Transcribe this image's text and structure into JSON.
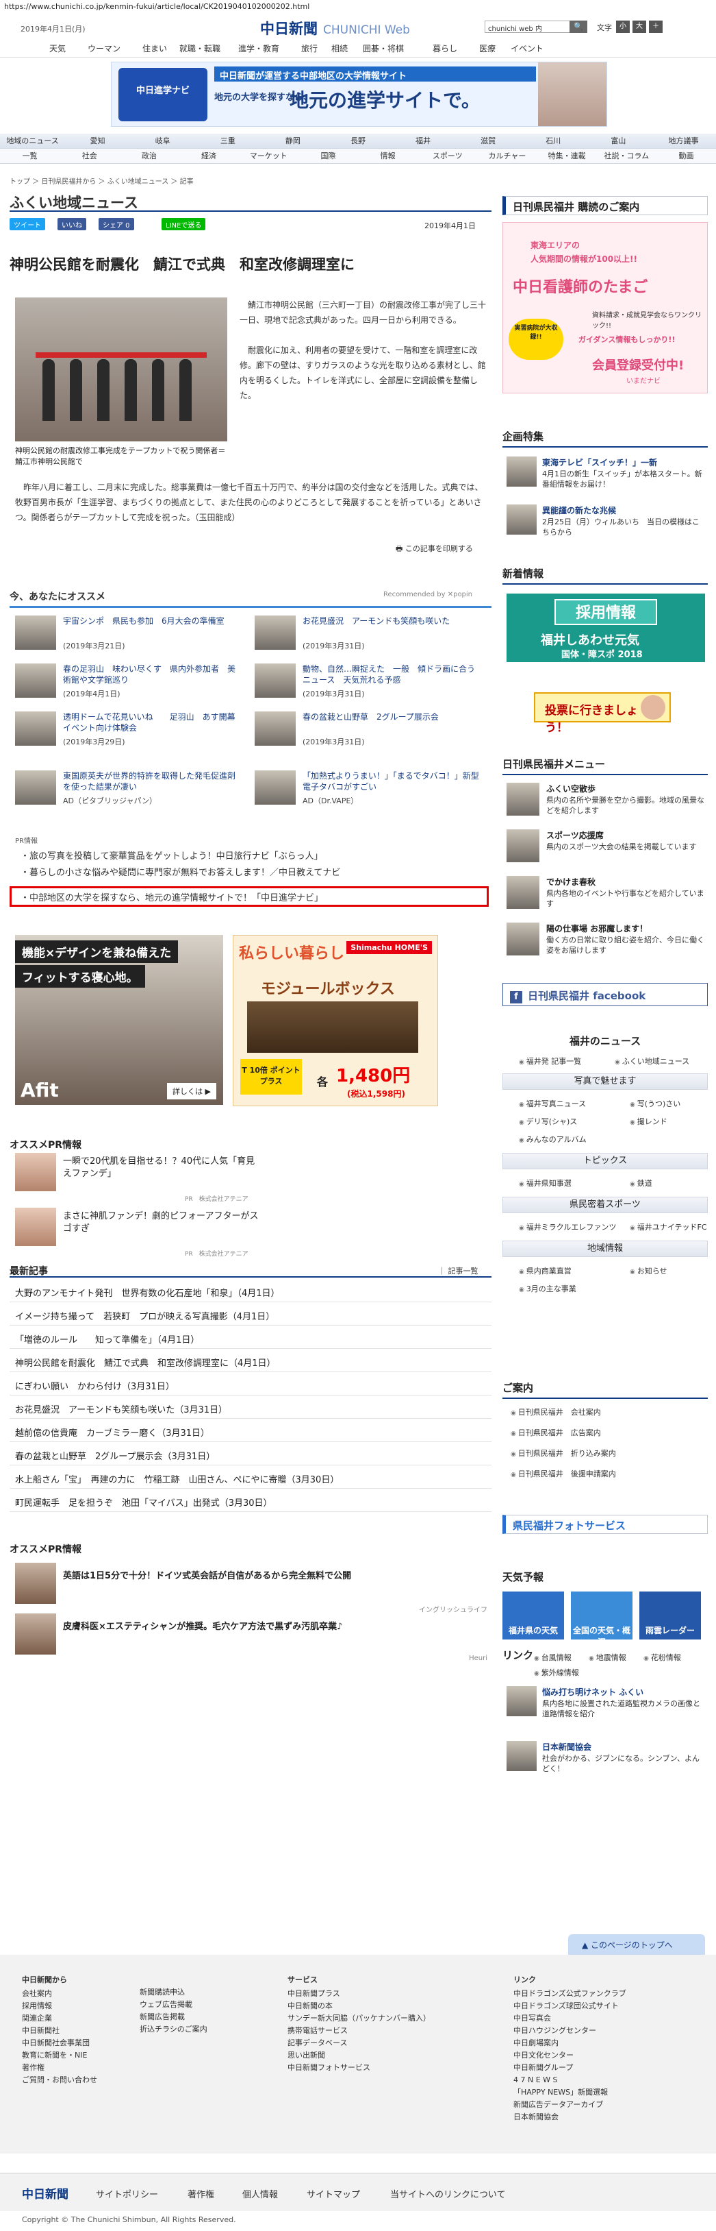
{
  "url": "https://www.chunichi.co.jp/kenmin-fukui/article/local/CK2019040102000202.html",
  "header": {
    "date": "2019年4月1日(月)",
    "logo": "中日新聞",
    "logo_sub": "CHUNICHI Web",
    "search_value": "chunichi web 内",
    "search_btn": "🔍",
    "font_label": "文字",
    "font_small": "小",
    "font_large": "大",
    "font_plus": "＋"
  },
  "topnav": [
    "天気",
    "ウーマン",
    "住まい",
    "就職・転職",
    "進学・教育",
    "旅行",
    "相続",
    "囲碁・将棋",
    "暮らし",
    "医療",
    "イベント"
  ],
  "banner": {
    "badge": "中日進学ナビ",
    "line1": "中日新聞が運営する中部地区の大学情報サイト",
    "line2": "地元の大学を探すなら、",
    "line3": "地元の進学サイトで。"
  },
  "secnav_row1": [
    "地域のニュース",
    "愛知",
    "岐阜",
    "三重",
    "静岡",
    "長野",
    "福井",
    "滋賀",
    "石川",
    "富山",
    "地方議事"
  ],
  "secnav_row2": [
    "一覧",
    "社会",
    "政治",
    "経済",
    "マーケット",
    "国際",
    "情報",
    "スポーツ",
    "カルチャー",
    "特集・連載",
    "社説・コラム",
    "動画"
  ],
  "crumb": "トップ ＞ 日刊県民福井から ＞ ふくい地域ニュース ＞ 記事",
  "page_title": "ふくい地域ニュース",
  "share": {
    "tweet": "ツイート",
    "fb": "いいね",
    "share": "シェア 0",
    "line": "LINEで送る"
  },
  "article": {
    "date": "2019年4月1日",
    "headline": "神明公民館を耐震化　鯖江で式典　和室改修調理室に",
    "caption": "神明公民館の耐震改修工事完成をテープカットで祝う関係者＝鯖江市神明公民館で",
    "p1": "鯖江市神明公民館（三六町一丁目）の耐震改修工事が完了し三十一日、現地で記念式典があった。四月一日から利用できる。",
    "p2": "耐震化に加え、利用者の要望を受けて、一階和室を調理室に改修。廊下の壁は、すりガラスのような光を取り込める素材とし、館内を明るくした。トイレを洋式にし、全部屋に空調設備を整備した。",
    "p3": "昨年八月に着工し、二月末に完成した。総事業費は一億七千百五十万円で、約半分は国の交付金などを活用した。式典では、牧野百男市長が「生涯学習、まちづくりの拠点として、また住民の心のよりどころとして発展することを祈っている」とあいさつ。関係者らがテープカットして完成を祝った。（玉田能成）",
    "print": "この記事を印刷する"
  },
  "rec": {
    "title": "今、あなたにオススメ",
    "by": "Recommended by ✕popin",
    "items": [
      {
        "t": "宇宙シンポ　県民も参加　6月大会の準備室",
        "d": "(2019年3月21日)"
      },
      {
        "t": "お花見盛況　アーモンドも笑顔も咲いた",
        "d": "(2019年3月31日)"
      },
      {
        "t": "春の足羽山　味わい尽くす　県内外参加者　美術館や文学館巡り",
        "d": "(2019年4月1日)"
      },
      {
        "t": "動物、自然…瞬捉えた　一般　傾ドラ画に合う　ニュース　天気荒れる予感",
        "d": "(2019年3月31日)"
      },
      {
        "t": "透明ドームで花見いいね　　足羽山　あす開幕イベント向け体験会",
        "d": "(2019年3月29日)"
      },
      {
        "t": "春の盆栽と山野草　2グループ展示会",
        "d": "(2019年3月31日)"
      },
      {
        "t": "東国原英夫が世界的特許を取得した発毛促進剤を使った結果が凄い",
        "d": "AD（ピタブリッジャパン）"
      },
      {
        "t": "「加熱式よりうまい！」「まるでタバコ！」新型電子タバコがすごい",
        "d": "AD（Dr.VAPE）"
      }
    ]
  },
  "pr": {
    "label": "PR情報",
    "lines": [
      "旅の写真を投稿して豪華賞品をゲットしよう！中日旅行ナビ「ぶらっ人」",
      "暮らしの小さな悩みや疑問に専門家が無料でお答えします！／中日教えてナビ",
      "中部地区の大学を探すなら、地元の進学情報サイトで！「中日進学ナビ」"
    ]
  },
  "ad1": {
    "l1": "機能×デザインを兼ね備えた",
    "l2": "フィットする寝心地。",
    "brand": "Afit",
    "more": "詳しくは ▶"
  },
  "ad2": {
    "l1": "私らしい暮らし",
    "l2": "モジュールボックス",
    "logo": "Shimachu HOME'S",
    "price": "1,480円",
    "kaku": "各",
    "tax": "(税込1,598円)",
    "point": "T 10倍 ポイントプラス"
  },
  "ospr1": {
    "title": "オススメPR情報",
    "items": [
      {
        "t": "一瞬で20代肌を目指せる！？40代に人気「育見えファンデ」",
        "s": "PR　株式会社アテニア"
      },
      {
        "t": "まさに神肌ファンデ！劇的ピフォーアフターがスゴすぎ",
        "s": "PR　株式会社アテニア"
      }
    ]
  },
  "latest": {
    "title": "最新記事",
    "more": "記事一覧",
    "items": [
      "大野のアンモナイト発刊　世界有数の化石産地「和泉」（4月1日）",
      "イメージ持ち撮って　若狭町　プロが映える写真撮影（4月1日）",
      "「増徳のルール　　知って準備を」（4月1日）",
      "神明公民館を耐震化　鯖江で式典　和室改修調理室に（4月1日）",
      "にぎわい願い　かわら付け（3月31日）",
      "お花見盛況　アーモンドも笑顔も咲いた（3月31日）",
      "越前億の信貴庵　カーブミラー磨く（3月31日）",
      "春の盆栽と山野草　2グループ展示会（3月31日）",
      "水上船さん「宝」　再建の力に　竹稲工跡　山田さん、ぺにやに寄贈（3月30日）",
      "町民運転手　足を担うぞ　池田「マイバス」出発式（3月30日）"
    ]
  },
  "ospr2": {
    "title": "オススメPR情報",
    "items": [
      {
        "t": "英語は1日5分で十分！ドイツ式英会話が自信があるから完全無料で公開",
        "s": "イングリッシュライフ"
      },
      {
        "t": "皮膚科医×エステティシャンが推奨。毛穴ケア方法で黒ずみ汚肌卒業♪",
        "s": "Heuri"
      }
    ]
  },
  "right": {
    "koudoku": "日刊県民福井 購読のご案内",
    "rad": {
      "t1": "東海エリアの",
      "t2": "人気期間の情報が100以上!!",
      "t3": "中日看護師のたまご",
      "t4": "資料請求・成就見学会ならワンクリック!!",
      "bubble": "実習病院が大収録!!",
      "t5": "ガイダンス情報もしっかり!!",
      "t6": "会員登録受付中!",
      "t7": "いまだナビ"
    },
    "kikaku": "企画特集",
    "kikaku_items": [
      {
        "t": "東海テレビ「スイッチ！」一新",
        "d": "4月1日の新生「スイッチ」が本格スタート。新番組情報をお届け！"
      },
      {
        "t": "異能謹の新たな兆候",
        "d": "2月25日（月）ウィルあいち　当日の模様はこちらから"
      }
    ],
    "shinsai": "新着情報",
    "recruit": {
      "a": "採用情報",
      "b": "福井しあわせ元気",
      "c": "国体・障スポ 2018"
    },
    "vote": "投票に行きましょう！",
    "menu_title": "日刊県民福井メニュー",
    "menu": [
      {
        "t": "ふくい空散歩",
        "d": "県内の名所や景勝を空から撮影。地域の風景などを紹介します"
      },
      {
        "t": "スポーツ応援席",
        "d": "県内のスポーツ大会の結果を掲載しています"
      },
      {
        "t": "でかけま春秋",
        "d": "県内各地のイベントや行事などを紹介しています"
      },
      {
        "t": "陽の仕事場 お邪魔します！",
        "d": "働く方の日常に取り組む姿を紹介、今日に働く姿をお届けします"
      }
    ],
    "fb": "日刊県民福井 facebook",
    "fukui_news": "福井のニュース",
    "fukui_links": [
      "福井発 記事一覧",
      "ふくい地域ニュース"
    ],
    "photo_h": "写真で魅せます",
    "photo_links": [
      "福井写真ニュース",
      "写(うつ)さい",
      "デリ写(シャ)ス",
      "撮レンド",
      "みんなのアルバム"
    ],
    "topics_h": "トピックス",
    "topics_links": [
      "福井県知事選",
      "鉄道"
    ],
    "sports_h": "県民密着スポーツ",
    "sports_links": [
      "福井ミラクルエレファンツ",
      "福井ユナイテッドFC"
    ],
    "region_h": "地域情報",
    "region_links": [
      "県内商業直営",
      "お知らせ",
      "3月の主な事業"
    ],
    "guide_h": "ご案内",
    "guide_links": [
      "日刊県民福井　会社案内",
      "日刊県民福井　広告案内",
      "日刊県民福井　折り込み案内",
      "日刊県民福井　後援申請案内"
    ],
    "photoservice": "県民福井フォトサービス",
    "weather_h": "天気予報",
    "weather": [
      "福井県の天気",
      "全国の天気・概況",
      "雨雲レーダー"
    ],
    "link_h": "リンク",
    "link_links": [
      "台風情報",
      "地震情報",
      "花粉情報",
      "紫外線情報"
    ],
    "link_items": [
      {
        "t": "悩み打ち明けネット ふくい",
        "d": "県内各地に設置された道路監視カメラの画像と道路情報を紹介"
      },
      {
        "t": "日本新聞協会",
        "d": "社会がわかる、ジブンになる。シンブン、よんどく！"
      }
    ]
  },
  "footer": {
    "top": "このページのトップへ",
    "col1": [
      "中日新聞から",
      "会社案内",
      "採用情報",
      "関連企業",
      "中日新聞社",
      "中日新聞社会事業団",
      "教育に新聞を・NIE",
      "著作権",
      "ご質問・お問い合わせ"
    ],
    "col2": [
      "新聞購読申込",
      "ウェブ広告掲載",
      "新聞広告掲載",
      "折込チラシのご案内"
    ],
    "col3": [
      "サービス",
      "中日新聞プラス",
      "中日新聞の本",
      "サンデー新大同脇（パッケナンバー購入）",
      "携帯電話サービス",
      "記事データベース",
      "思い出新聞",
      "中日新聞フォトサービス"
    ],
    "col4": [
      "リンク",
      "中日ドラゴンズ公式ファンクラブ",
      "中日ドラゴンズ球団公式サイト",
      "中日写真会",
      "中日ハウジングセンター",
      "中日劇場案内",
      "中日文化センター",
      "中日新聞グループ",
      "4 7 N E W S",
      "「HAPPY NEWS」新聞選報",
      "新聞広告データアーカイブ",
      "日本新聞協会"
    ],
    "bottom": [
      "サイトポリシー",
      "著作権",
      "個人情報",
      "サイトマップ",
      "当サイトへのリンクについて"
    ],
    "logo": "中日新聞",
    "copyright": "Copyright © The Chunichi Shimbun, All Rights Reserved."
  },
  "colors": {
    "brand": "#0f3a86",
    "accent": "#3b87d5",
    "highlight": "#e00000"
  }
}
